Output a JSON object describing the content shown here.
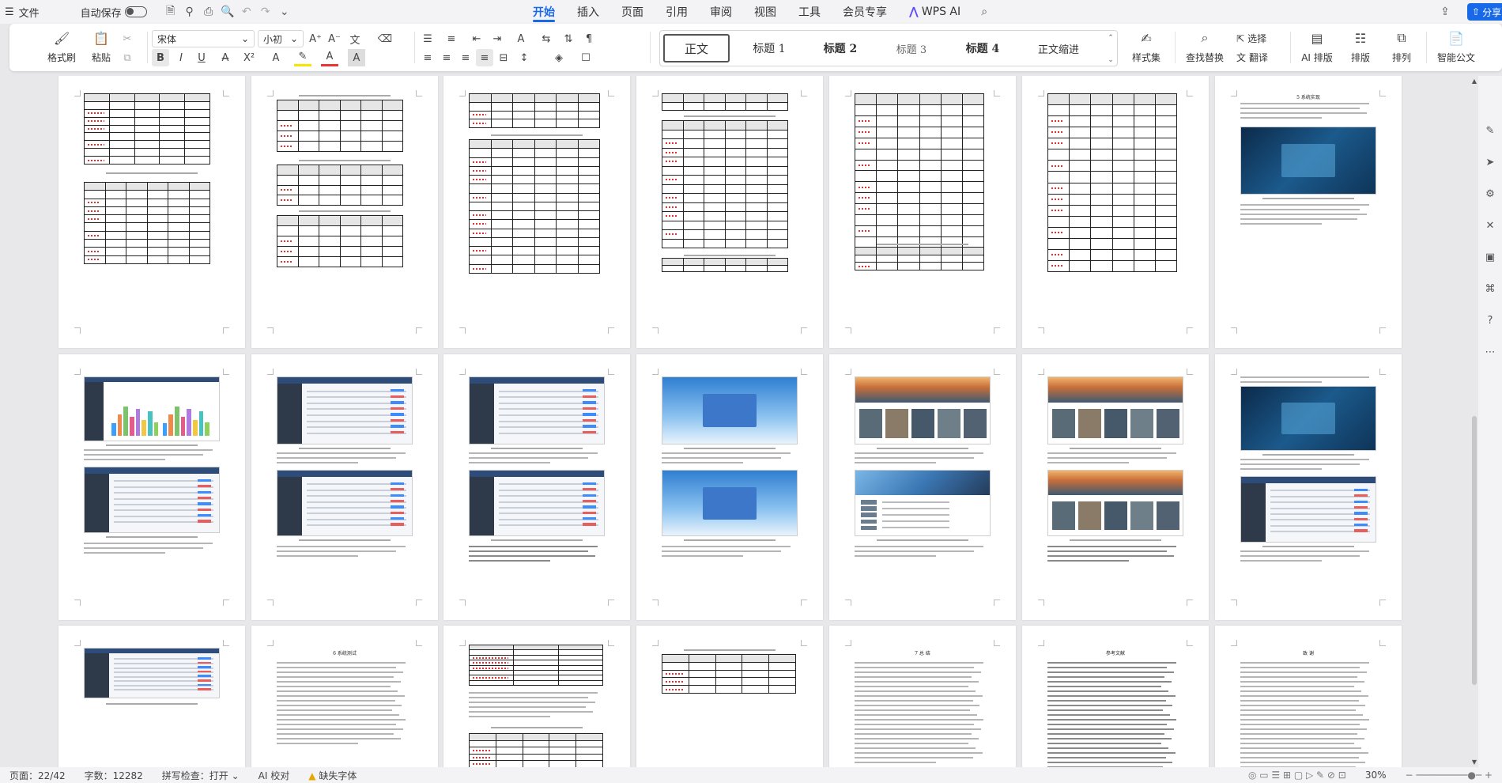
{
  "menubar": {
    "file_label": "文件",
    "autosave_label": "自动保存",
    "tabs": [
      {
        "label": "开始",
        "active": true
      },
      {
        "label": "插入"
      },
      {
        "label": "页面"
      },
      {
        "label": "引用"
      },
      {
        "label": "审阅"
      },
      {
        "label": "视图"
      },
      {
        "label": "工具"
      },
      {
        "label": "会员专享"
      }
    ],
    "wps_ai_label": "WPS AI",
    "share_label": "分享"
  },
  "ribbon": {
    "format_painter": "格式刷",
    "paste": "粘贴",
    "font_name": "宋体",
    "font_size": "小初",
    "styles": [
      "正文",
      "标题 1",
      "标题 2",
      "标题 3",
      "标题 4",
      "正文缩进"
    ],
    "styles_set": "样式集",
    "find_replace": "查找替换",
    "select": "选择",
    "translate": "翻译",
    "ai_layout": "AI 排版",
    "layout": "排版",
    "arrange": "排列",
    "smart_doc": "智能公文"
  },
  "statusbar": {
    "page": "页面：22/42",
    "words": "字数：12282",
    "spellcheck": "拼写检查：打开",
    "ai_check": "AI 校对",
    "missing_font": "缺失字体",
    "zoom": "30%"
  },
  "pages": {
    "p7_title": "5 系统实现",
    "p16_title": "6 系统测试",
    "p19_title": "7 总 结",
    "p20_title": "参考文献",
    "p21_title": "致 谢"
  },
  "colors": {
    "accent": "#1769e8",
    "squiggle": "#d33333"
  }
}
